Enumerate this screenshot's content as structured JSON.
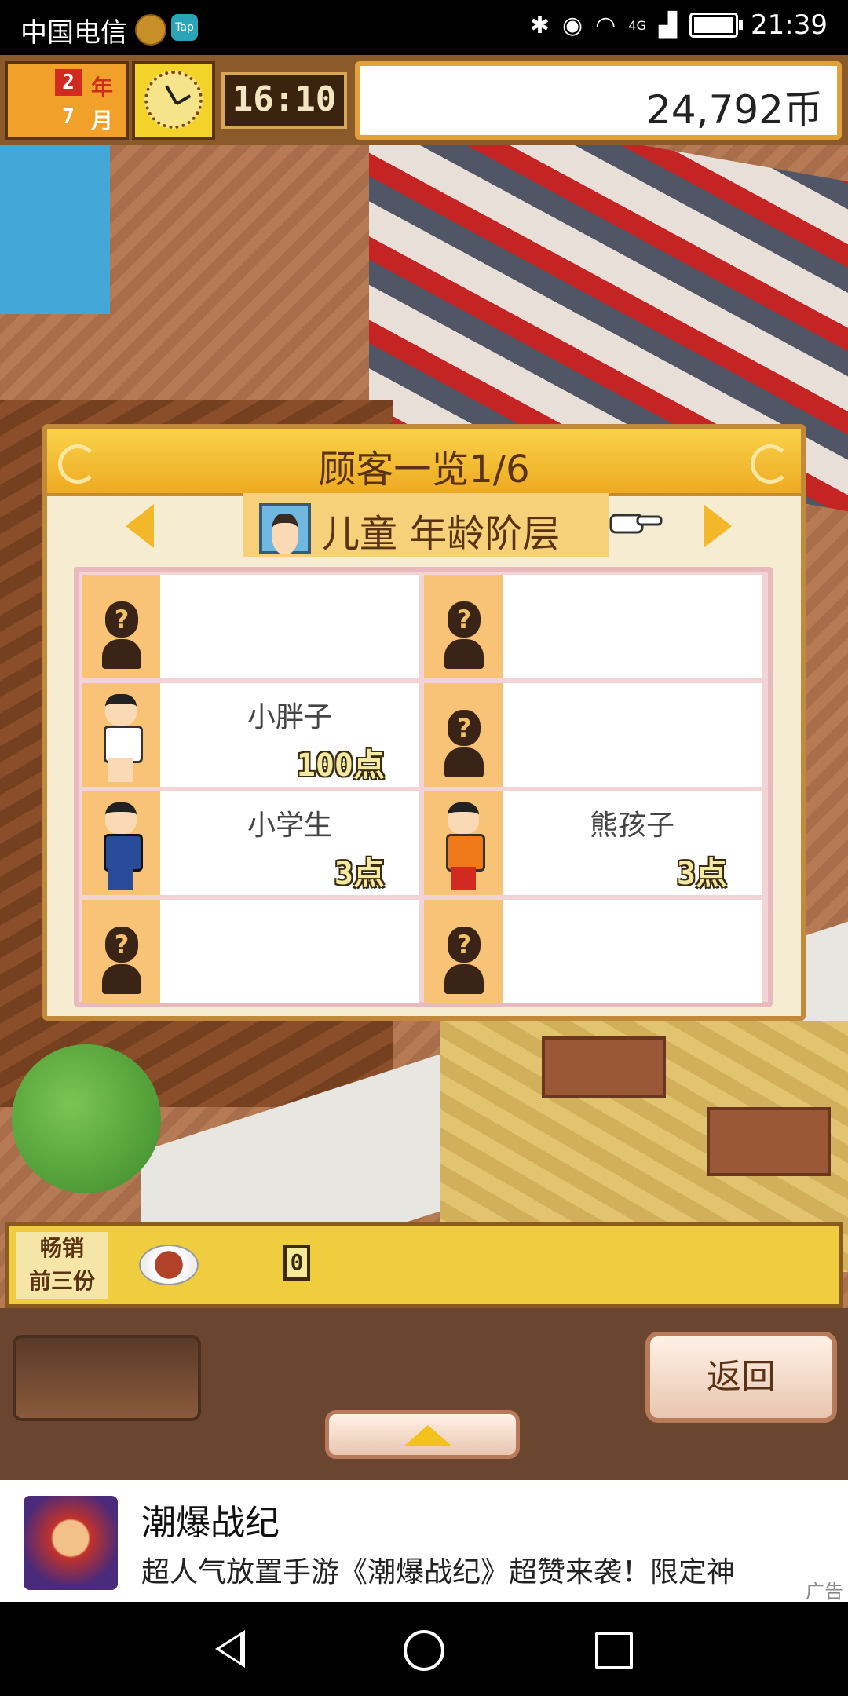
{
  "status_bar": {
    "carrier": "中国电信",
    "tap_label": "Tap",
    "network": "4G",
    "time": "21:39"
  },
  "hud": {
    "year_num": "2",
    "year_label": "年",
    "month_num": "7",
    "month_label": "月",
    "time": "16:10",
    "money": "24,792币"
  },
  "dialog": {
    "title": "顾客一览1/6",
    "category": "儿童 年龄阶层",
    "cells": [
      {
        "name": "",
        "points": "",
        "known": false
      },
      {
        "name": "",
        "points": "",
        "known": false
      },
      {
        "name": "小胖子",
        "points": "100点",
        "known": true
      },
      {
        "name": "",
        "points": "",
        "known": false
      },
      {
        "name": "小学生",
        "points": "3点",
        "known": true
      },
      {
        "name": "熊孩子",
        "points": "3点",
        "known": true
      },
      {
        "name": "",
        "points": "",
        "known": false
      },
      {
        "name": "",
        "points": "",
        "known": false
      }
    ]
  },
  "bestseller": {
    "label_line1": "畅销",
    "label_line2": "前三份",
    "count": "0"
  },
  "controls": {
    "back_label": "返回"
  },
  "ad": {
    "title": "潮爆战纪",
    "description": "超人气放置手游《潮爆战纪》超赞来袭！限定神",
    "tag": "广告"
  },
  "colors": {
    "accent_gold": "#f0cd3e",
    "portrait_bg": "#f8c376",
    "dialog_bg": "#f6ecd2"
  }
}
